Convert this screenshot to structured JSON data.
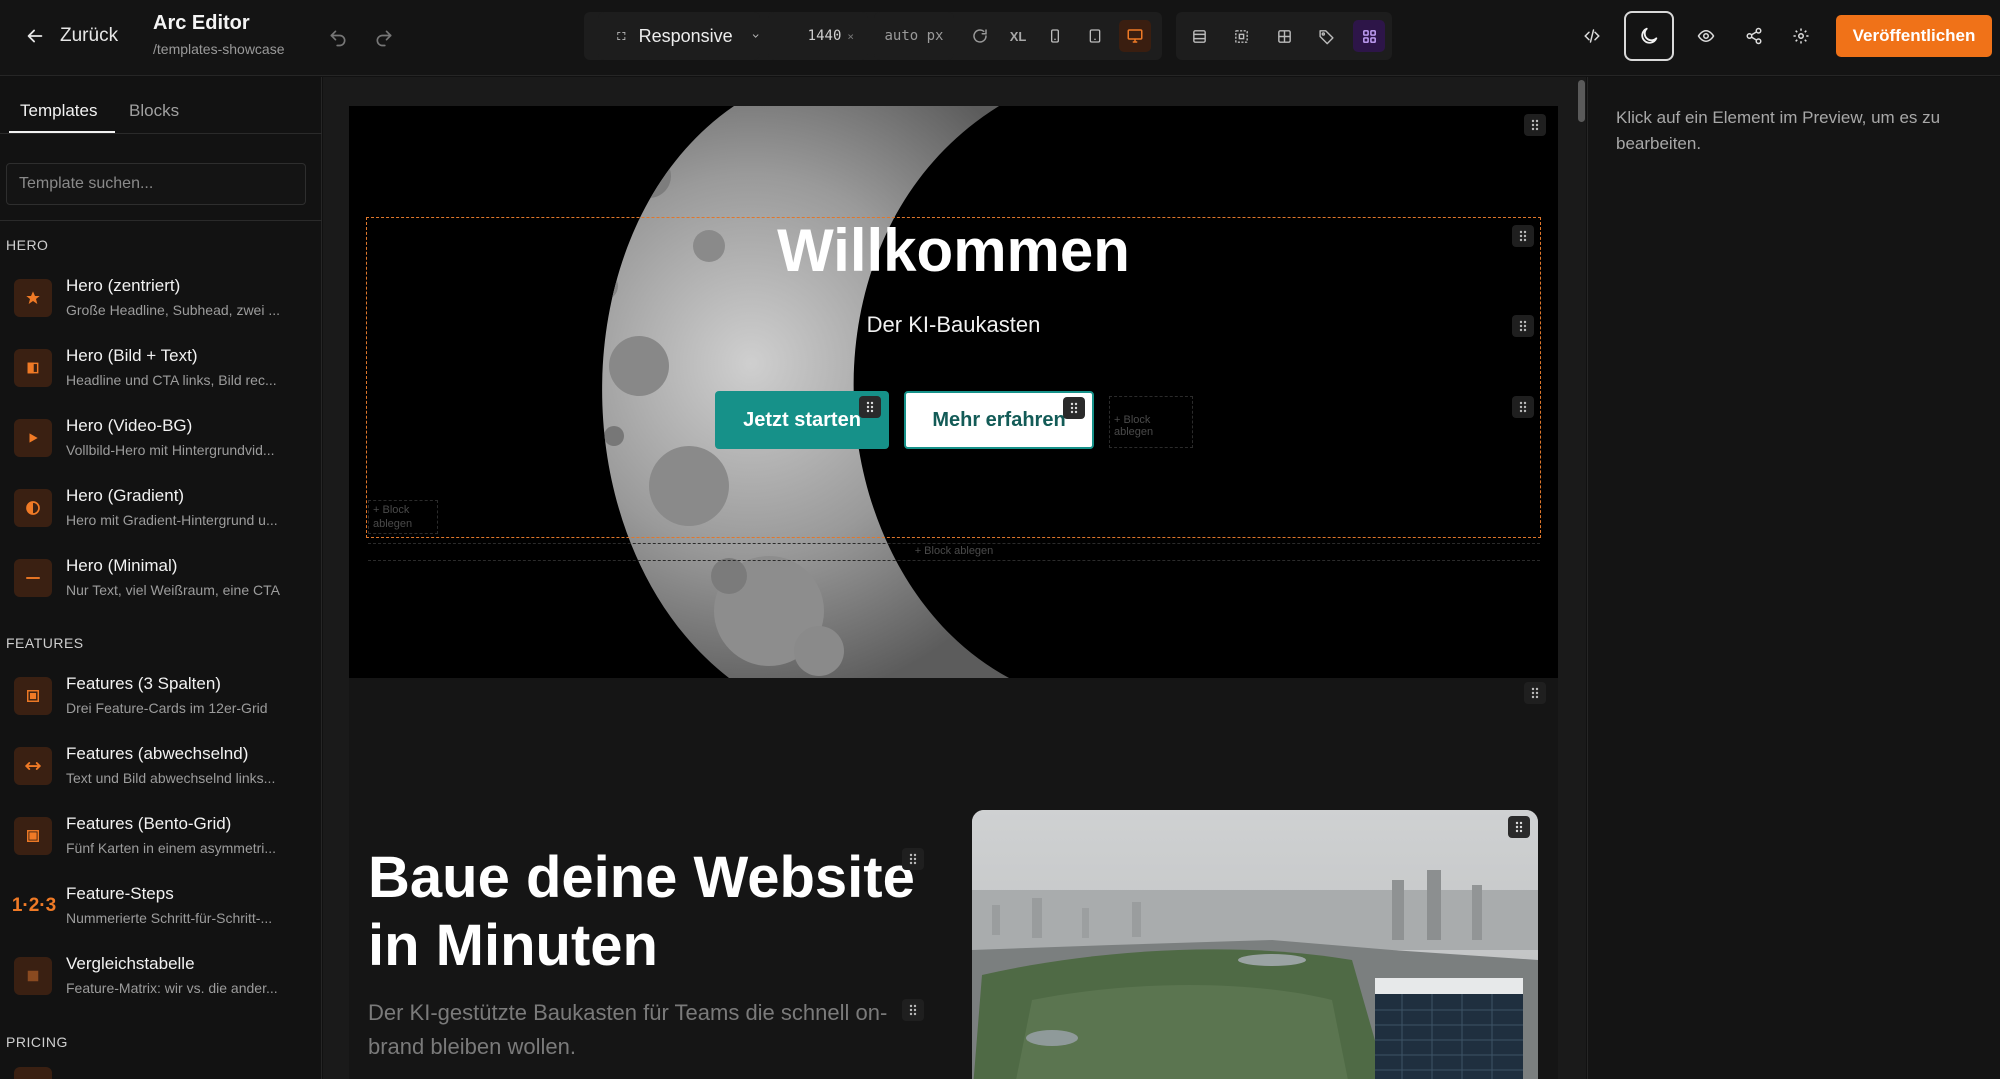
{
  "header": {
    "back_label": "Zurück",
    "app_title": "Arc Editor",
    "app_path": "/templates-showcase",
    "viewport_mode": "Responsive",
    "width_value": "1440",
    "width_clear": "×",
    "height_value": "auto px",
    "breakpoint_xl": "XL",
    "publish_label": "Veröffentlichen",
    "accent_color": "#f07218"
  },
  "sidebar": {
    "tabs": [
      {
        "label": "Templates",
        "active": true
      },
      {
        "label": "Blocks",
        "active": false
      }
    ],
    "search_placeholder": "Template suchen...",
    "sections": [
      {
        "title": "HERO",
        "items": [
          {
            "title": "Hero (zentriert)",
            "desc": "Große Headline, Subhead, zwei ...",
            "icon": "star-icon"
          },
          {
            "title": "Hero (Bild + Text)",
            "desc": "Headline und CTA links, Bild rec...",
            "icon": "split-icon"
          },
          {
            "title": "Hero (Video-BG)",
            "desc": "Vollbild-Hero mit Hintergrundvid...",
            "icon": "play-icon"
          },
          {
            "title": "Hero (Gradient)",
            "desc": "Hero mit Gradient-Hintergrund u...",
            "icon": "half-circle-icon"
          },
          {
            "title": "Hero (Minimal)",
            "desc": "Nur Text, viel Weißraum, eine CTA",
            "icon": "dash-icon"
          }
        ]
      },
      {
        "title": "FEATURES",
        "items": [
          {
            "title": "Features (3 Spalten)",
            "desc": "Drei Feature-Cards im 12er-Grid",
            "icon": "grid-icon"
          },
          {
            "title": "Features (abwechselnd)",
            "desc": "Text und Bild abwechselnd links...",
            "icon": "arrows-icon"
          },
          {
            "title": "Features (Bento-Grid)",
            "desc": "Fünf Karten in einem asymmetri...",
            "icon": "bento-icon"
          },
          {
            "title": "Feature-Steps",
            "desc": "Nummerierte Schritt-für-Schritt-...",
            "icon_text": "1·2·3"
          },
          {
            "title": "Vergleichstabelle",
            "desc": "Feature-Matrix: wir vs. die ander...",
            "icon": "table-icon"
          }
        ]
      },
      {
        "title": "PRICING",
        "items": []
      }
    ]
  },
  "preview": {
    "hero_title": "Willkommen",
    "hero_subtitle": "Der KI-Baukasten",
    "cta_primary": "Jetzt starten",
    "cta_secondary": "Mehr erfahren",
    "drop_hint": "+ Block ablegen",
    "section_title_line1": "Baue deine Website",
    "section_title_line2": "in Minuten",
    "section_subtitle": "Der KI-gestützte Baukasten für Teams die schnell on-brand bleiben wollen.",
    "cta_color": "#169189"
  },
  "inspector": {
    "hint": "Klick auf ein Element im Preview, um es zu bearbeiten."
  }
}
